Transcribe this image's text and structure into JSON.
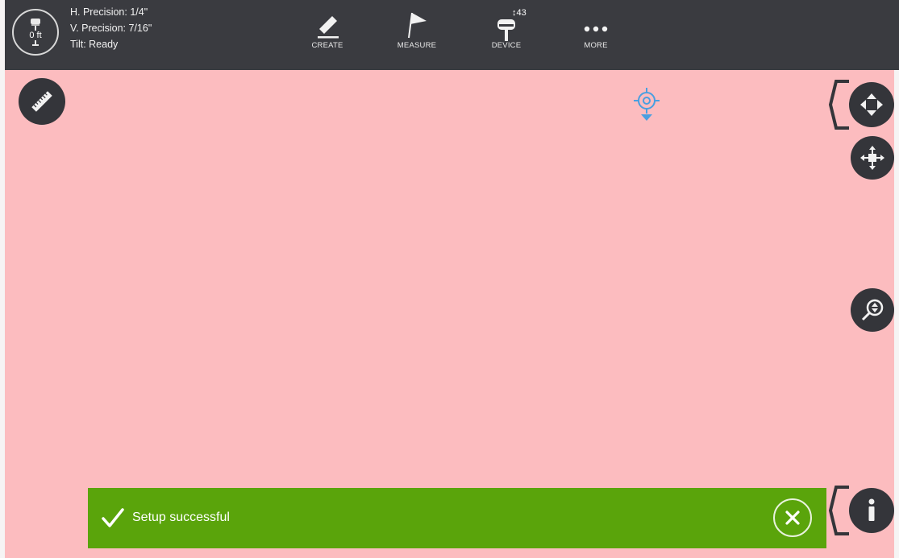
{
  "device": {
    "height_label": "0 ft"
  },
  "status": {
    "h_precision": "H. Precision:  1/4\"",
    "v_precision": "V. Precision:  7/16\"",
    "tilt": "Tilt:  Ready"
  },
  "nav": {
    "create": "CREATE",
    "measure": "MEASURE",
    "device": "DEVICE",
    "device_count": "43",
    "more": "MORE"
  },
  "toast": {
    "message": "Setup successful"
  },
  "icons": {
    "ruler": "ruler-icon",
    "pan": "pan-arrows-icon",
    "move": "move-icon",
    "zoom": "zoom-icon",
    "info": "info-icon",
    "target": "crosshair-target-icon"
  },
  "colors": {
    "map_background": "#fcbcbf",
    "topbar": "#3a3b40",
    "toast": "#5aa40b",
    "round_button": "#34353a",
    "target": "#4a9fe0"
  }
}
